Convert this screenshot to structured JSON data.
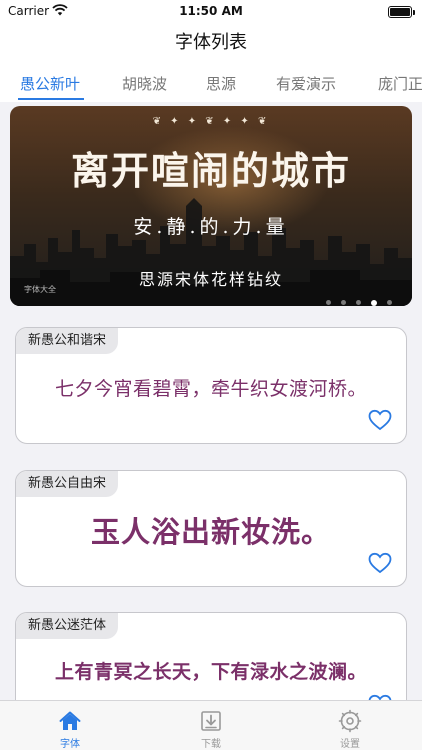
{
  "status_bar": {
    "carrier": "Carrier",
    "time": "11:50 AM"
  },
  "nav": {
    "title": "字体列表"
  },
  "tabs": [
    {
      "label": "愚公新叶",
      "active": true
    },
    {
      "label": "胡晓波",
      "active": false
    },
    {
      "label": "思源",
      "active": false
    },
    {
      "label": "有爱演示",
      "active": false
    },
    {
      "label": "庞门正",
      "active": false
    }
  ],
  "banner": {
    "headline": "离开喧闹的城市",
    "subline": "安.静.的.力.量",
    "font_name": "思源宋体花样钻纹",
    "watermark": "字体大全",
    "page_count": 5,
    "active_page": 4
  },
  "cards": [
    {
      "font_name": "新愚公和谐宋",
      "sample": "七夕今宵看碧霄，牵牛织女渡河桥。"
    },
    {
      "font_name": "新愚公自由宋",
      "sample": "玉人浴出新妆洗。"
    },
    {
      "font_name": "新愚公迷茫体",
      "sample": "上有青冥之长天，下有渌水之波澜。"
    }
  ],
  "tab_bar": [
    {
      "label": "字体",
      "icon": "home-icon",
      "active": true
    },
    {
      "label": "下载",
      "icon": "download-icon",
      "active": false
    },
    {
      "label": "设置",
      "icon": "settings-icon",
      "active": false
    }
  ],
  "colors": {
    "accent": "#2a7ae2",
    "sample_text": "#7b3069"
  }
}
